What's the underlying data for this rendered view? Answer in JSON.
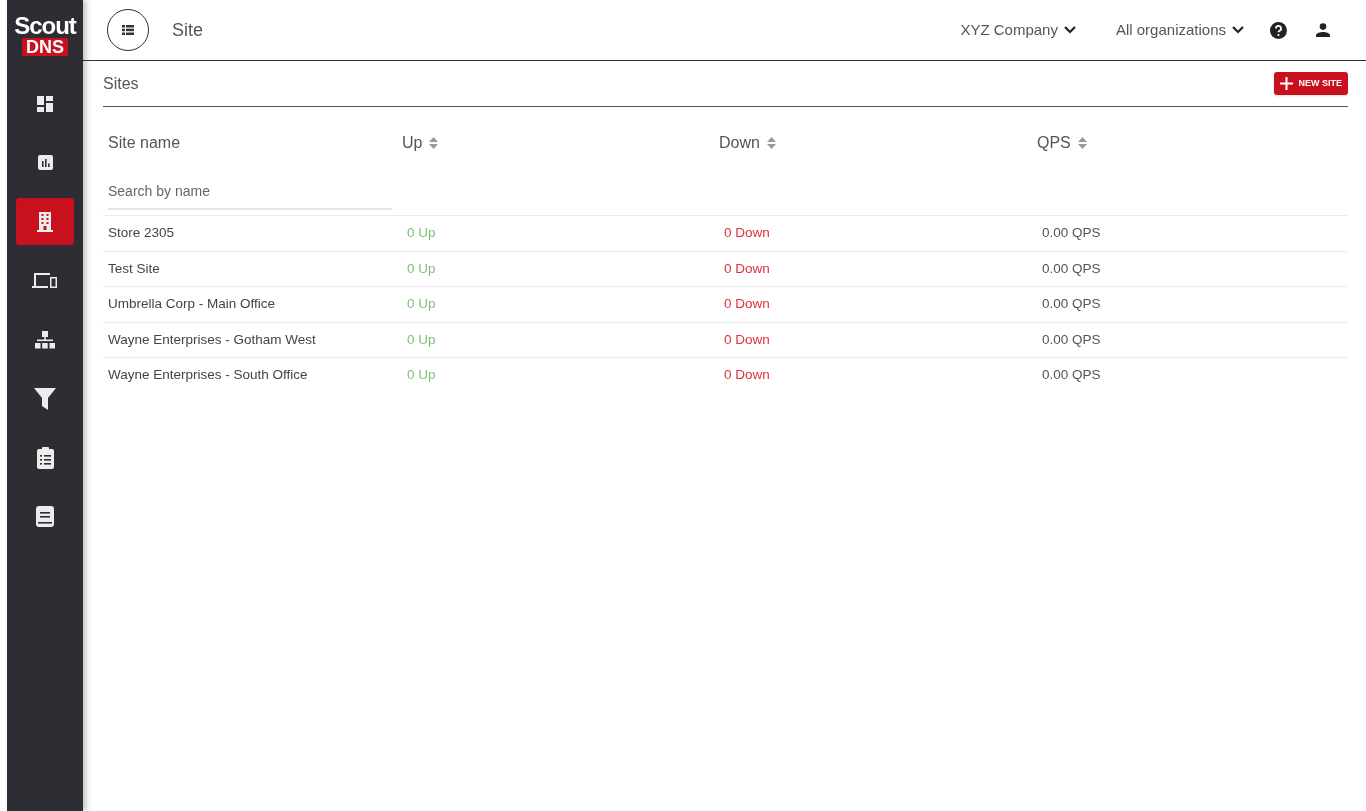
{
  "logo": {
    "line_1": "Scout",
    "line_2": "DNS"
  },
  "sidebar": {
    "items": [
      {
        "selected": false
      },
      {
        "selected": false
      },
      {
        "selected": true
      },
      {
        "selected": false
      },
      {
        "selected": false
      },
      {
        "selected": false
      },
      {
        "selected": false
      },
      {
        "selected": false
      }
    ]
  },
  "header": {
    "title": "Site",
    "company": "XYZ Company",
    "organization": "All organizations"
  },
  "section": {
    "title": "Sites",
    "new_button": "NEW SITE"
  },
  "table": {
    "columns": [
      "Site name",
      "Up",
      "Down",
      "QPS"
    ],
    "search": {
      "placeholder": "Search by name"
    },
    "rows": [
      {
        "name": "Store 2305",
        "up": "0 Up",
        "down": "0 Down",
        "qps": "0.00 QPS"
      },
      {
        "name": "Test Site",
        "up": "0 Up",
        "down": "0 Down",
        "qps": "0.00 QPS"
      },
      {
        "name": "Umbrella Corp - Main Office",
        "up": "0 Up",
        "down": "0 Down",
        "qps": "0.00 QPS"
      },
      {
        "name": "Wayne Enterprises - Gotham West",
        "up": "0 Up",
        "down": "0 Down",
        "qps": "0.00 QPS"
      },
      {
        "name": "Wayne Enterprises - South Office",
        "up": "0 Up",
        "down": "0 Down",
        "qps": "0.00 QPS"
      }
    ]
  }
}
